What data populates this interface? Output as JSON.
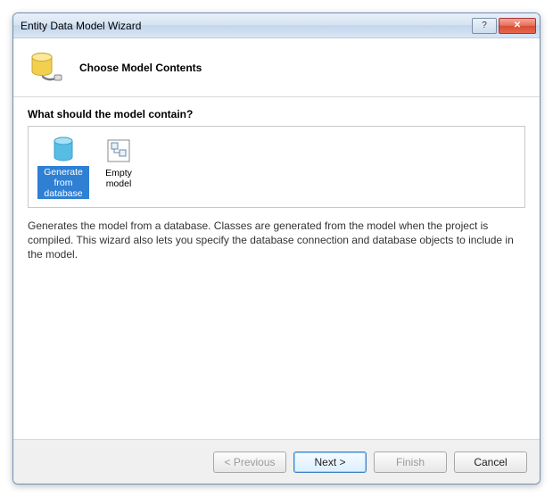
{
  "window": {
    "title": "Entity Data Model Wizard"
  },
  "header": {
    "title": "Choose Model Contents"
  },
  "content": {
    "question": "What should the model contain?",
    "options": [
      {
        "label": "Generate\nfrom\ndatabase",
        "selected": true,
        "icon": "database-icon"
      },
      {
        "label": "Empty model",
        "selected": false,
        "icon": "empty-model-icon"
      }
    ],
    "description": "Generates the model from a database. Classes are generated from the model when the project is compiled. This wizard also lets you specify the database connection and database objects to include in the model."
  },
  "footer": {
    "previous": "< Previous",
    "next": "Next >",
    "finish": "Finish",
    "cancel": "Cancel"
  }
}
